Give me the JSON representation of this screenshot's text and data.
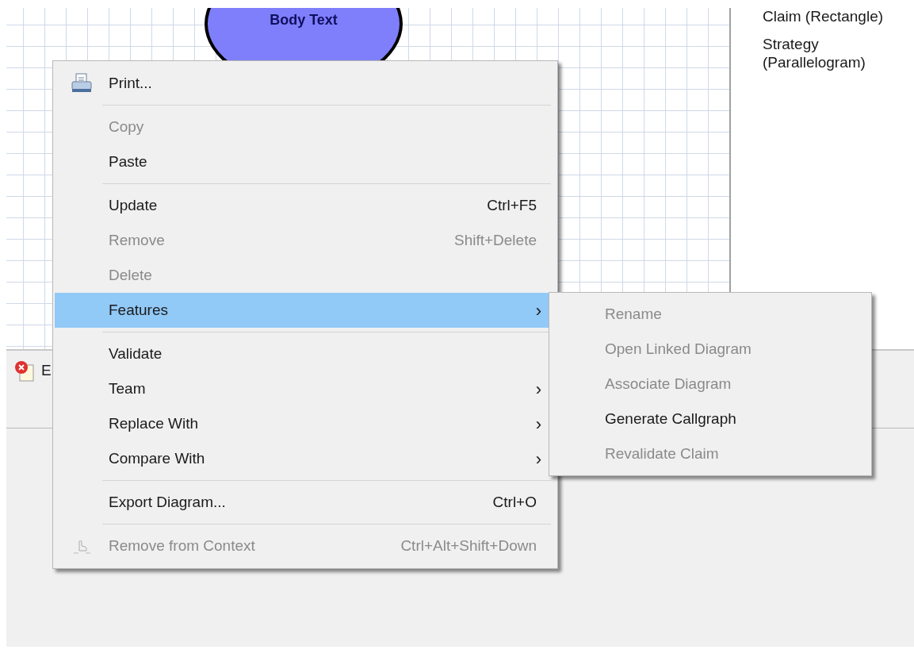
{
  "diagram": {
    "node_label": "Body Text"
  },
  "palette": {
    "items": [
      {
        "label": "Claim (Rectangle)"
      },
      {
        "label": "Strategy (Parallelogram)"
      }
    ]
  },
  "bottom_panel": {
    "tabs": [
      {
        "label": "E"
      }
    ]
  },
  "context_menu": {
    "items": [
      {
        "kind": "item",
        "label": "Print...",
        "disabled": false,
        "selected": false
      },
      {
        "kind": "separator"
      },
      {
        "kind": "item",
        "label": "Copy",
        "disabled": true,
        "selected": false
      },
      {
        "kind": "item",
        "label": "Paste",
        "disabled": false,
        "selected": false
      },
      {
        "kind": "separator"
      },
      {
        "kind": "item",
        "label": "Update",
        "shortcut": "Ctrl+F5",
        "disabled": false,
        "selected": false
      },
      {
        "kind": "item",
        "label": "Remove",
        "shortcut": "Shift+Delete",
        "disabled": true,
        "selected": false
      },
      {
        "kind": "item",
        "label": "Delete",
        "disabled": true,
        "selected": false
      },
      {
        "kind": "item",
        "label": "Features",
        "submenu_arrow": "›",
        "disabled": false,
        "selected": true
      },
      {
        "kind": "separator"
      },
      {
        "kind": "item",
        "label": "Validate",
        "disabled": false,
        "selected": false
      },
      {
        "kind": "item",
        "label": "Team",
        "submenu_arrow": "›",
        "disabled": false,
        "selected": false
      },
      {
        "kind": "item",
        "label": "Replace With",
        "submenu_arrow": "›",
        "disabled": false,
        "selected": false
      },
      {
        "kind": "item",
        "label": "Compare With",
        "submenu_arrow": "›",
        "disabled": false,
        "selected": false
      },
      {
        "kind": "separator"
      },
      {
        "kind": "item",
        "label": "Export Diagram...",
        "shortcut": "Ctrl+O",
        "disabled": false,
        "selected": false
      },
      {
        "kind": "separator"
      },
      {
        "kind": "item",
        "label": "Remove from Context",
        "shortcut": "Ctrl+Alt+Shift+Down",
        "disabled": true,
        "selected": false
      }
    ]
  },
  "submenu": {
    "items": [
      {
        "label": "Rename",
        "disabled": true
      },
      {
        "label": "Open Linked Diagram",
        "disabled": true
      },
      {
        "label": "Associate Diagram",
        "disabled": true
      },
      {
        "label": "Generate Callgraph",
        "disabled": false
      },
      {
        "label": "Revalidate Claim",
        "disabled": true
      }
    ]
  }
}
